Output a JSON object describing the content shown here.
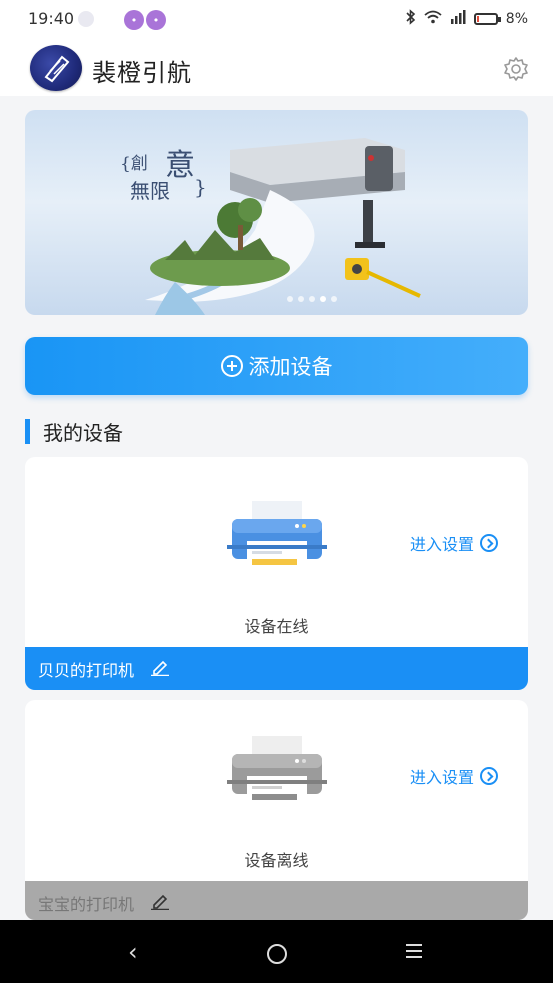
{
  "status_bar": {
    "time": "19:40",
    "battery": "8%",
    "battery_level": 0.08,
    "battery_color": "#e14e3c",
    "icons": [
      "moon-icon",
      "notification-icon",
      "notification-icon",
      "bluetooth-icon",
      "wifi-icon",
      "signal-icon",
      "battery-icon"
    ]
  },
  "header": {
    "title": "裴橙引航",
    "settings_icon": "gear-icon"
  },
  "banner": {
    "slogan_small_left": "{創",
    "slogan_big_top": "意",
    "slogan_big_bottom": "無限",
    "slogan_brace": "}",
    "dots_total": 5,
    "dots_active_index": 3
  },
  "add_device_button": {
    "label": "添加设备",
    "icon": "plus-circle-icon"
  },
  "section": {
    "title": "我的设备",
    "accent_color": "#1a90f5"
  },
  "devices": [
    {
      "name": "贝贝的打印机",
      "status": "设备在线",
      "enter_label": "进入设置",
      "online": true,
      "bar_color": "#1a8ff5"
    },
    {
      "name": "宝宝的打印机",
      "status": "设备离线",
      "enter_label": "进入设置",
      "online": false,
      "bar_color": "#a9a9a9"
    }
  ],
  "nav": {
    "back": "‹",
    "icons": [
      "back-icon",
      "home-icon",
      "menu-icon"
    ]
  }
}
